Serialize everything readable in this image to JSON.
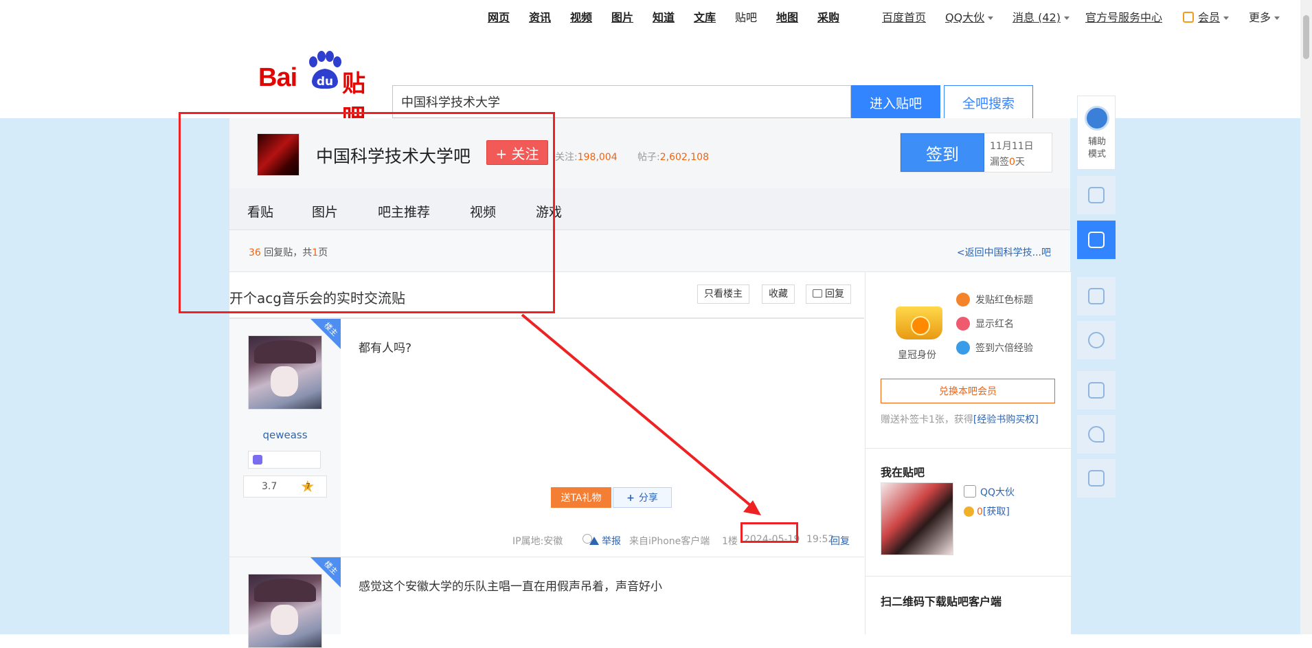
{
  "topnav": {
    "links": [
      "网页",
      "资讯",
      "视频",
      "图片",
      "知道",
      "文库",
      "贴吧",
      "地图",
      "采购"
    ],
    "right": [
      "百度首页",
      "QQ大伙",
      "消息 (42)",
      "官方号服务中心",
      "会员",
      "更多"
    ]
  },
  "header": {
    "logo_text_bai": "Bai",
    "logo_text_du": "du",
    "logo_text_tieba": "贴吧",
    "search_value": "中国科学技术大学",
    "enter_label": "进入贴吧",
    "allsearch_label": "全吧搜索"
  },
  "forum": {
    "name": "中国科学技术大学吧",
    "follow_label": "+ 关注",
    "followers_label": "关注:",
    "followers": "198,004",
    "posts_label": "帖子:",
    "posts": "2,602,108",
    "sign_label": "签到",
    "sign_date": "11月11日",
    "miss_prefix": "漏签",
    "miss_days": "0",
    "miss_suffix": "天",
    "tabs": [
      "看贴",
      "图片",
      "吧主推荐",
      "视频",
      "游戏"
    ]
  },
  "thread": {
    "reply_count": "36",
    "reply_text": "回复贴，共",
    "page_count": "1",
    "page_suffix": "页",
    "back_link": "<返回中国科学技...吧",
    "title": "开个acg音乐会的实时交流贴",
    "btn_only_op": "只看楼主",
    "btn_favorite": "收藏",
    "btn_reply": "回复",
    "corner_label": "楼主",
    "posts": [
      {
        "username": "qeweass",
        "level": "3.7",
        "level_star": "7",
        "content": "都有人吗?",
        "gift_label": "送TA礼物",
        "share_label": "分享",
        "ip": "IP属地:安徽",
        "report": "举报",
        "client": "来自iPhone客户端",
        "floor": "1楼",
        "date": "2024-05-19",
        "time": "19:52",
        "reply": "回复"
      },
      {
        "content": "感觉这个安徽大学的乐队主唱一直在用假声吊着，声音好小"
      }
    ]
  },
  "aside": {
    "crown_label": "皇冠身份",
    "perks": [
      "发贴红色标题",
      "显示红名",
      "签到六倍经验"
    ],
    "exchange_label": "兑换本吧会员",
    "bonus_text": "赠送补签卡1张，获得",
    "bonus_link": "[经验书购买权]",
    "my_tieba_title": "我在贴吧",
    "my_name": "QQ大伙",
    "my_coins": "0",
    "my_coins_link": "[获取]",
    "qr_title": "扫二维码下载贴吧客户端"
  },
  "floatbar": {
    "assist_label_1": "辅助",
    "assist_label_2": "模式"
  },
  "colors": {
    "brand_red": "#e10601",
    "brand_blue": "#3385ff",
    "annotation_red": "#ee2222",
    "accent_orange": "#f2630e"
  }
}
